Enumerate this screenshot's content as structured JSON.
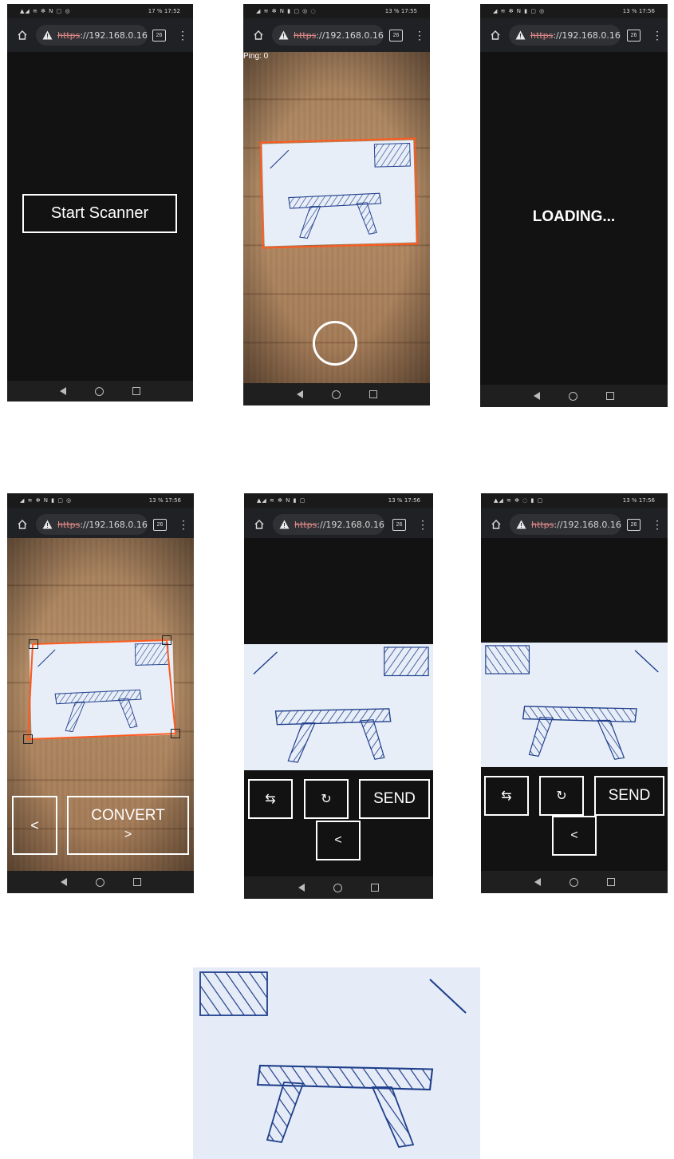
{
  "shared": {
    "url_scheme": "https",
    "url_host": "://192.168.0.16",
    "tab_count": "26",
    "menu_glyph": "⋮"
  },
  "screens": [
    {
      "status_time": "17:52",
      "status_battery": "17 %",
      "status_icons": "▲◢ ≋ ✻ N ▢ ◎",
      "button_label": "Start Scanner"
    },
    {
      "status_time": "17:55",
      "status_battery": "13 %",
      "status_icons": "◢ ≋ ✻ N ▮ ▢ ◎ ◌",
      "ping_label": "Ping: 0"
    },
    {
      "status_time": "17:56",
      "status_battery": "13 %",
      "status_icons": "◢ ≋ ✻ N ▮ ▢ ◎",
      "loading_label": "LOADING..."
    },
    {
      "status_time": "17:56",
      "status_battery": "13 %",
      "status_icons": "◢ ≋ ✻ N ▮ ▢ ◎",
      "back_label": "<",
      "convert_label": "CONVERT",
      "convert_arrow": ">"
    },
    {
      "status_time": "17:56",
      "status_battery": "13 %",
      "status_icons": "▲◢ ≋ ✻ N ▮ ▢",
      "swap_label": "⇆",
      "rotate_label": "↻",
      "send_label": "SEND",
      "back_label": "<"
    },
    {
      "status_time": "17:56",
      "status_battery": "13 %",
      "status_icons": "▲◢ ≋ ✻ ◌ ▮ ▢",
      "swap_label": "⇆",
      "rotate_label": "↻",
      "send_label": "SEND",
      "back_label": "<"
    }
  ],
  "colors": {
    "crop_outline": "#ff5a1f",
    "button_border": "#ffffff",
    "app_background": "#121212",
    "sketch_ink": "#1f3f8c"
  }
}
